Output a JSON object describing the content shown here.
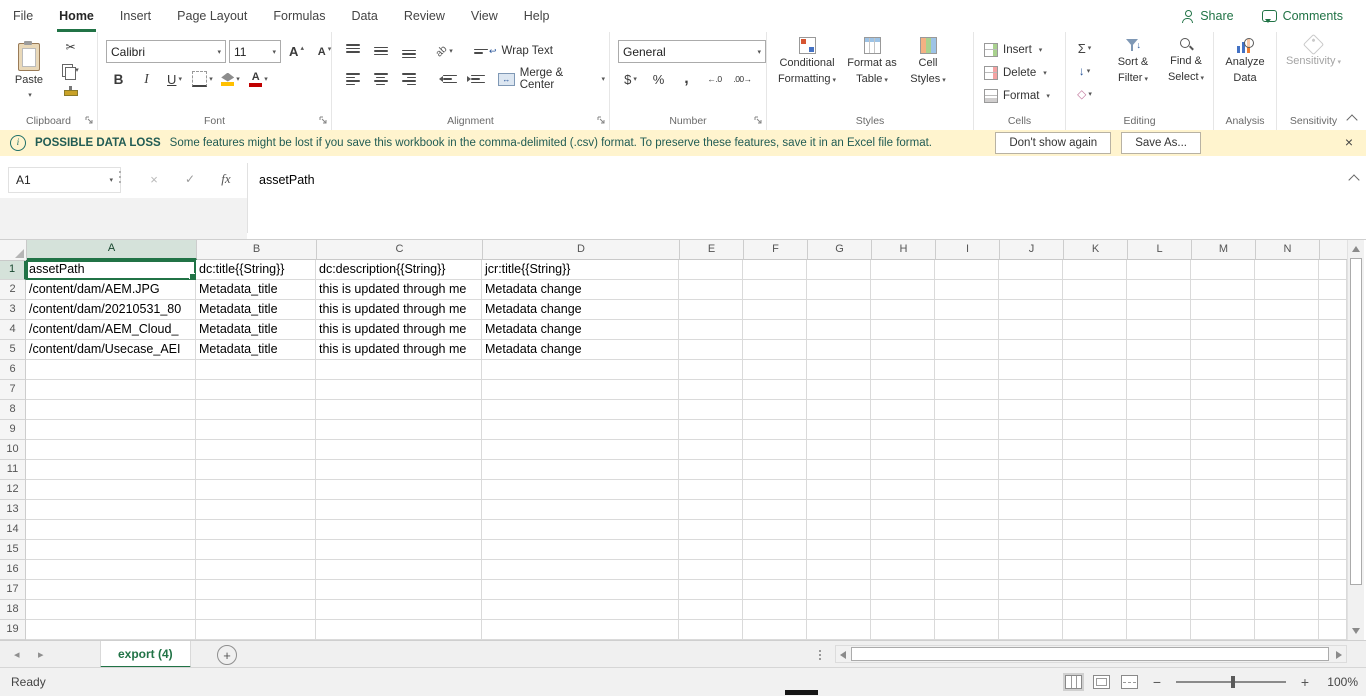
{
  "menu": {
    "items": [
      "File",
      "Home",
      "Insert",
      "Page Layout",
      "Formulas",
      "Data",
      "Review",
      "View",
      "Help"
    ],
    "active": "Home",
    "share_label": "Share",
    "comments_label": "Comments"
  },
  "ribbon": {
    "clipboard": {
      "group_label": "Clipboard",
      "paste_label": "Paste"
    },
    "font": {
      "group_label": "Font",
      "font_name": "Calibri",
      "font_size": "11",
      "bold": "B",
      "italic": "I",
      "underline": "U",
      "increase": "A",
      "decrease": "A",
      "color_letter": "A"
    },
    "alignment": {
      "group_label": "Alignment",
      "wrap_text": "Wrap Text",
      "merge_center": "Merge & Center",
      "orientation_glyph": "ab"
    },
    "number": {
      "group_label": "Number",
      "format": "General",
      "currency": "$",
      "percent": "%",
      "comma": ","
    },
    "styles": {
      "group_label": "Styles",
      "conditional_line1": "Conditional",
      "conditional_line2": "Formatting",
      "table_line1": "Format as",
      "table_line2": "Table",
      "cellstyles_line1": "Cell",
      "cellstyles_line2": "Styles"
    },
    "cells": {
      "group_label": "Cells",
      "insert": "Insert",
      "delete": "Delete",
      "format": "Format"
    },
    "editing": {
      "group_label": "Editing",
      "autosum": "Σ",
      "sort_line1": "Sort &",
      "sort_line2": "Filter",
      "find_line1": "Find &",
      "find_line2": "Select"
    },
    "analysis": {
      "group_label": "Analysis",
      "analyze_line1": "Analyze",
      "analyze_line2": "Data"
    },
    "sensitivity": {
      "group_label": "Sensitivity",
      "button_label": "Sensitivity"
    }
  },
  "message_bar": {
    "title": "POSSIBLE DATA LOSS",
    "message": "Some features might be lost if you save this workbook in the comma-delimited (.csv) format. To preserve these features, save it in an Excel file format.",
    "dont_show_label": "Don't show again",
    "save_as_label": "Save As..."
  },
  "formula_bar": {
    "name_box": "A1",
    "fx": "fx",
    "content": "assetPath"
  },
  "sheet": {
    "columns": [
      "A",
      "B",
      "C",
      "D",
      "E",
      "F",
      "G",
      "H",
      "I",
      "J",
      "K",
      "L",
      "M",
      "N"
    ],
    "visible_rows": 19,
    "selected_cell": "A1",
    "cells": [
      [
        "assetPath",
        "dc:title{{String}}",
        "dc:description{{String}}",
        "jcr:title{{String}}"
      ],
      [
        "/content/dam/AEM.JPG",
        "Metadata_title",
        "this is updated through me",
        "Metadata change"
      ],
      [
        "/content/dam/20210531_80",
        "Metadata_title",
        "this is updated through me",
        "Metadata change"
      ],
      [
        "/content/dam/AEM_Cloud_",
        "Metadata_title",
        "this is updated through me",
        "Metadata change"
      ],
      [
        "/content/dam/Usecase_AEI",
        "Metadata_title",
        "this is updated through me",
        "Metadata change"
      ]
    ]
  },
  "sheet_tabs": {
    "active_tab": "export (4)"
  },
  "status_bar": {
    "status": "Ready",
    "zoom": "100%"
  }
}
